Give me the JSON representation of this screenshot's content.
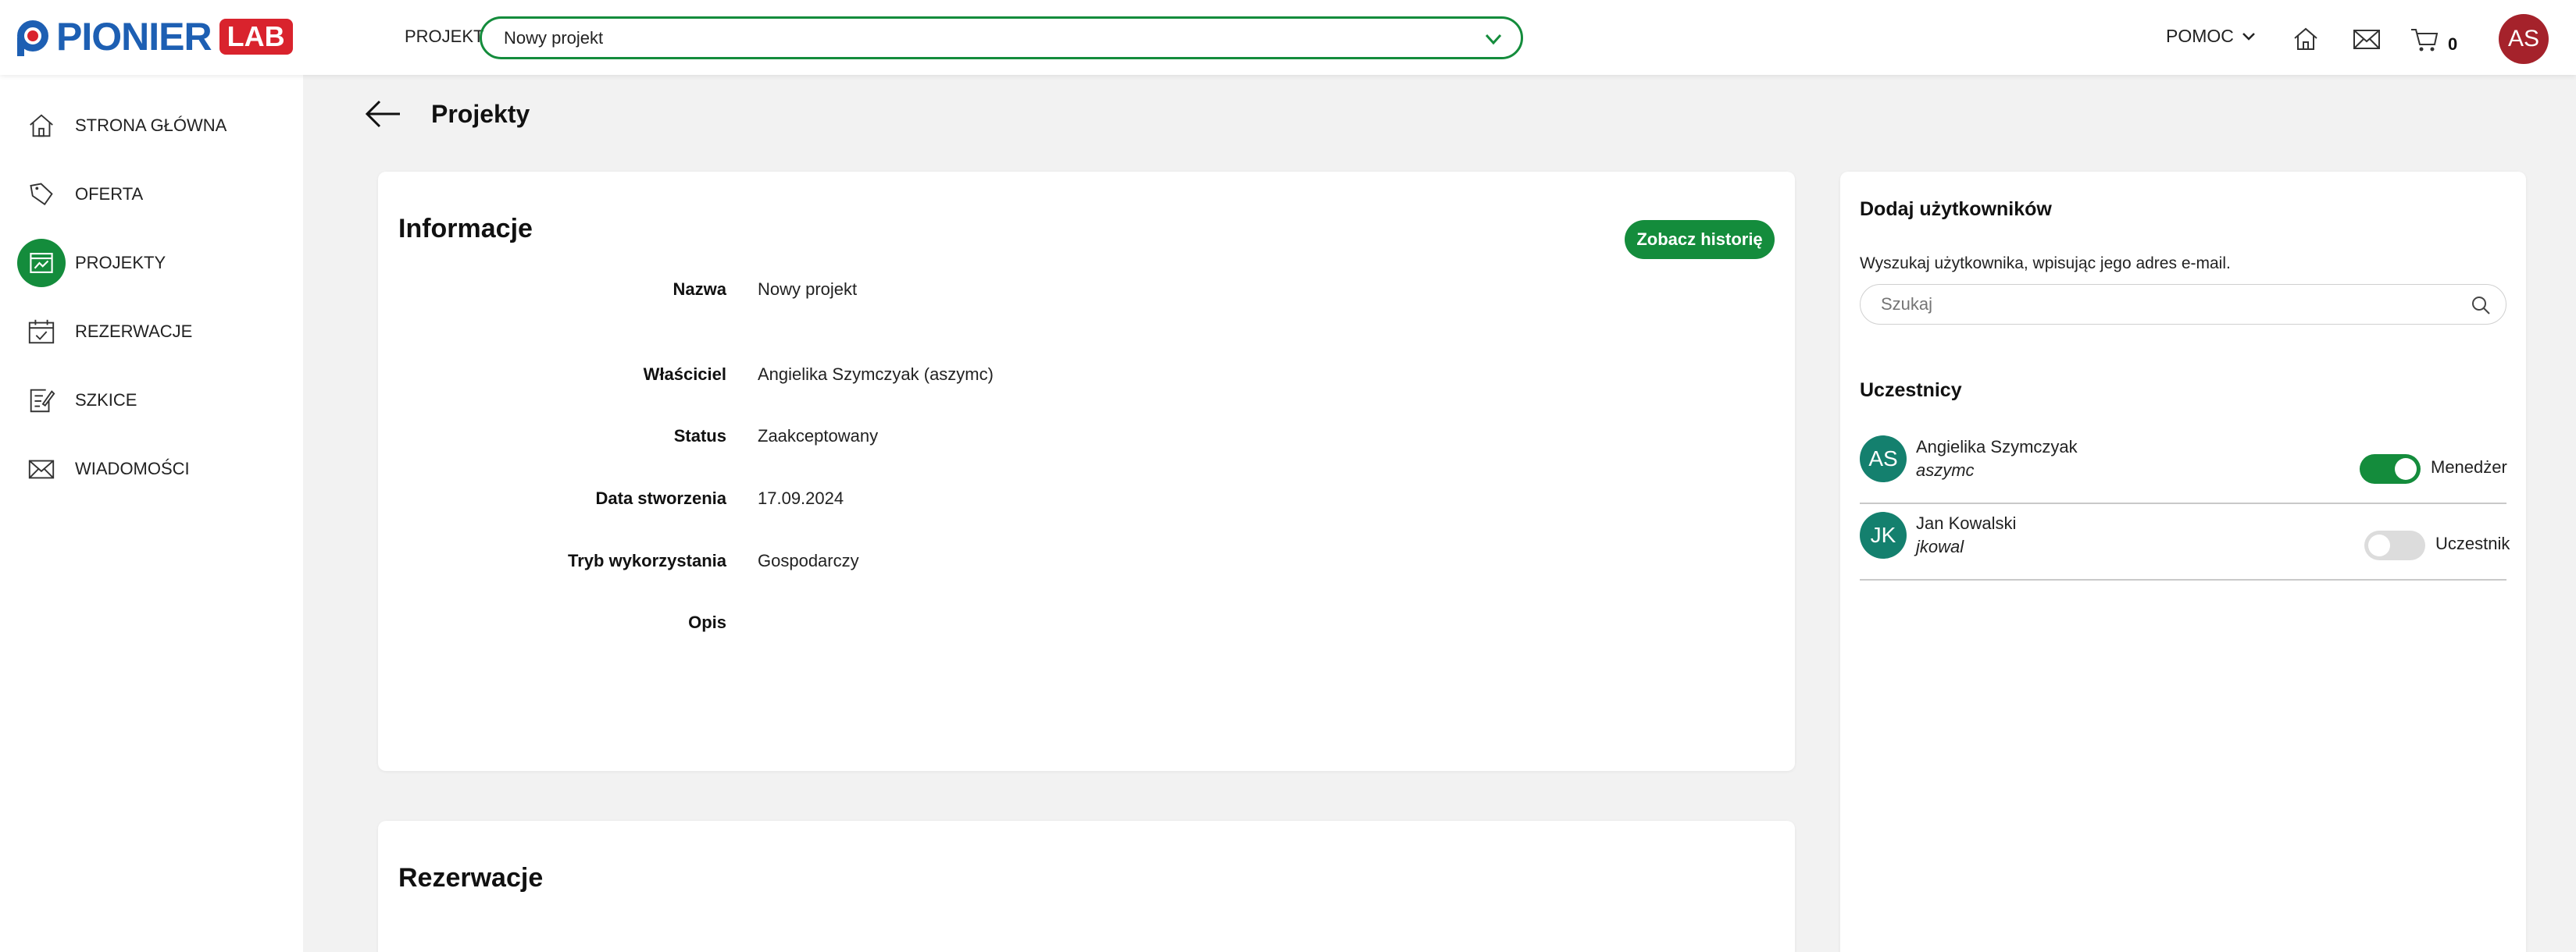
{
  "header": {
    "logo_text": "PIONIER",
    "logo_badge": "LAB",
    "project_label": "PROJEKT",
    "project_selected": "Nowy projekt",
    "help_label": "POMOC",
    "cart_count": "0",
    "user_initials": "AS"
  },
  "sidebar": {
    "items": [
      {
        "label": "STRONA GŁÓWNA",
        "icon": "home-icon"
      },
      {
        "label": "OFERTA",
        "icon": "tag-icon"
      },
      {
        "label": "PROJEKTY",
        "icon": "projects-icon",
        "active": true
      },
      {
        "label": "REZERWACJE",
        "icon": "calendar-icon"
      },
      {
        "label": "SZKICE",
        "icon": "draft-icon"
      },
      {
        "label": "WIADOMOŚCI",
        "icon": "mail-icon"
      }
    ]
  },
  "page": {
    "title": "Projekty"
  },
  "info": {
    "title": "Informacje",
    "history_button": "Zobacz historię",
    "rows": [
      {
        "label": "Nazwa",
        "value": "Nowy projekt"
      },
      {
        "label": "Właściciel",
        "value": "Angielika Szymczyak (aszymc)"
      },
      {
        "label": "Status",
        "value": "Zaakceptowany"
      },
      {
        "label": "Data stworzenia",
        "value": "17.09.2024"
      },
      {
        "label": "Tryb wykorzystania",
        "value": "Gospodarczy"
      },
      {
        "label": "Opis",
        "value": ""
      }
    ]
  },
  "reservations": {
    "title": "Rezerwacje"
  },
  "users": {
    "title": "Dodaj użytkowników",
    "hint": "Wyszukaj użytkownika, wpisując jego adres e-mail.",
    "search_placeholder": "Szukaj",
    "participants_title": "Uczestnicy",
    "participants": [
      {
        "initials": "AS",
        "name": "Angielika Szymczyak",
        "login": "aszymc",
        "role": "Menedżer",
        "manager": true
      },
      {
        "initials": "JK",
        "name": "Jan Kowalski",
        "login": "jkowal",
        "role": "Uczestnik",
        "manager": false
      }
    ]
  },
  "colors": {
    "accent_green": "#148c3c",
    "brand_blue": "#1d5fb3",
    "brand_red": "#d9232d",
    "avatar_red": "#a5222b",
    "avatar_teal": "#14806e"
  }
}
